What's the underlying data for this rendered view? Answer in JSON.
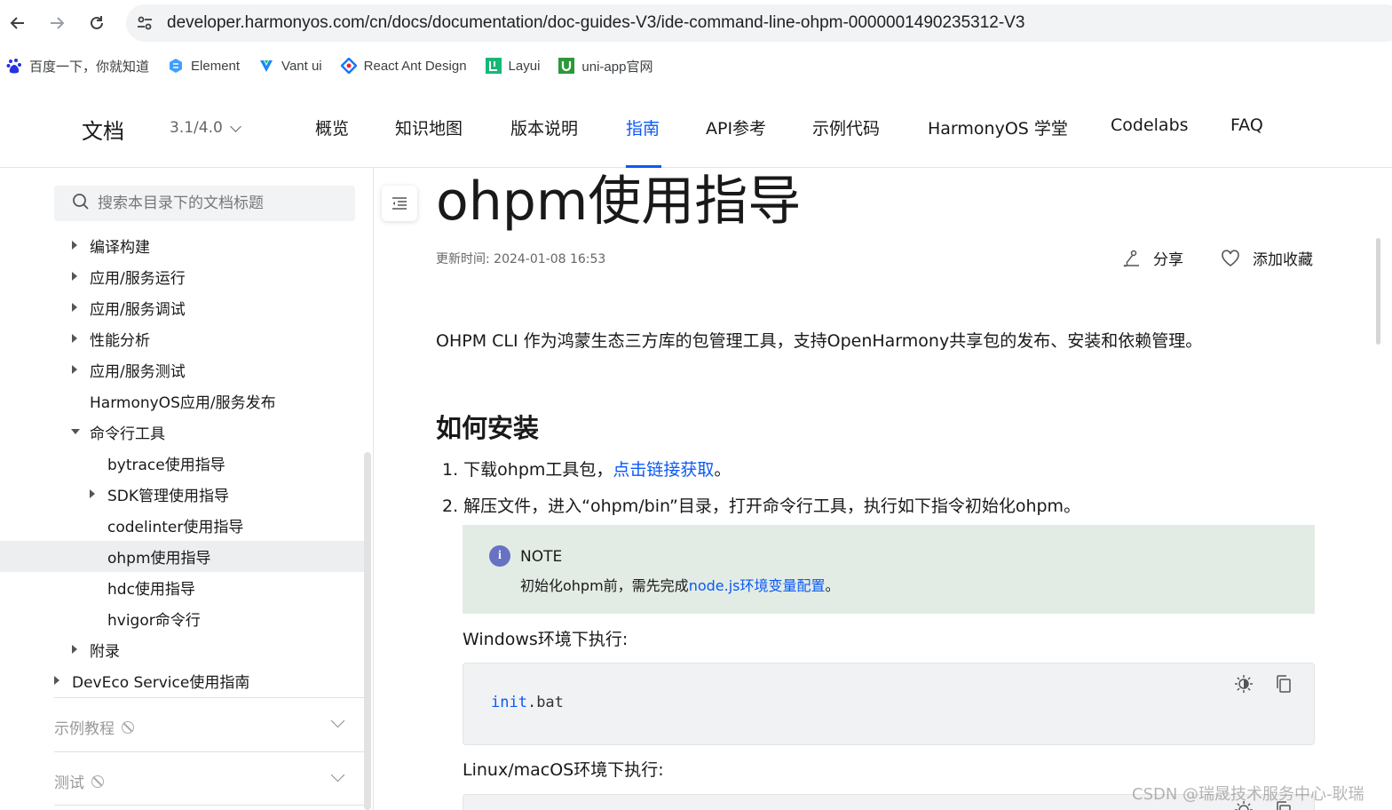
{
  "browser": {
    "url": "developer.harmonyos.com/cn/docs/documentation/doc-guides-V3/ide-command-line-ohpm-0000001490235312-V3",
    "bookmarks": [
      {
        "label": "百度一下，你就知道",
        "icon": "baidu-icon",
        "color": "#2932e1"
      },
      {
        "label": "Element",
        "icon": "element-icon",
        "color": "#409eff"
      },
      {
        "label": "Vant ui",
        "icon": "vant-icon",
        "color": "#1989fa"
      },
      {
        "label": "React Ant Design",
        "icon": "antd-icon",
        "color": "#1677ff"
      },
      {
        "label": "Layui",
        "icon": "layui-icon",
        "color": "#16b777"
      },
      {
        "label": "uni-app官网",
        "icon": "uniapp-icon",
        "color": "#2b9939"
      }
    ]
  },
  "header": {
    "logo": "文档",
    "version": "3.1/4.0",
    "nav": [
      "概览",
      "知识地图",
      "版本说明",
      "指南",
      "API参考",
      "示例代码",
      "HarmonyOS 学堂",
      "Codelabs",
      "FAQ"
    ],
    "active_nav": "指南",
    "accent": "#0a59f7"
  },
  "sidebar": {
    "search_placeholder": "搜索本目录下的文档标题",
    "items": [
      {
        "label": "编译构建",
        "expander": "collapsed"
      },
      {
        "label": "应用/服务运行",
        "expander": "collapsed"
      },
      {
        "label": "应用/服务调试",
        "expander": "collapsed"
      },
      {
        "label": "性能分析",
        "expander": "collapsed"
      },
      {
        "label": "应用/服务测试",
        "expander": "collapsed"
      },
      {
        "label": "HarmonyOS应用/服务发布",
        "expander": "none"
      },
      {
        "label": "命令行工具",
        "expander": "expanded"
      },
      {
        "label": "bytrace使用指导",
        "expander": "none"
      },
      {
        "label": "SDK管理使用指导",
        "expander": "collapsed"
      },
      {
        "label": "codelinter使用指导",
        "expander": "none"
      },
      {
        "label": "ohpm使用指导",
        "expander": "none",
        "active": true
      },
      {
        "label": "hdc使用指导",
        "expander": "none"
      },
      {
        "label": "hvigor命令行",
        "expander": "none"
      },
      {
        "label": "附录",
        "expander": "collapsed"
      },
      {
        "label": "DevEco Service使用指南",
        "expander": "collapsed"
      }
    ],
    "sections": [
      "示例教程",
      "测试"
    ]
  },
  "main": {
    "title": "ohpm使用指导",
    "updated": "更新时间: 2024-01-08 16:53",
    "share_label": "分享",
    "favorite_label": "添加收藏",
    "intro": "OHPM CLI 作为鸿蒙生态三方库的包管理工具，支持OpenHarmony共享包的发布、安装和依赖管理。",
    "install_heading": "如何安装",
    "step1_prefix": "1. 下载ohpm工具包，",
    "step1_link": "点击链接获取",
    "step1_suffix": "。",
    "step2": "2. 解压文件，进入“ohpm/bin”目录，打开命令行工具，执行如下指令初始化ohpm。",
    "note": {
      "title": "NOTE",
      "body_prefix": "初始化ohpm前，需先完成",
      "body_link": "node.js环境变量配置",
      "body_suffix": "。",
      "bg": "#e3ece4"
    },
    "windows_label": "Windows环境下执行:",
    "windows_code_keyword": "init",
    "windows_code_rest": ".bat",
    "linux_label": "Linux/macOS环境下执行:"
  },
  "watermark": "CSDN @瑞晟技术服务中心-耿瑞"
}
